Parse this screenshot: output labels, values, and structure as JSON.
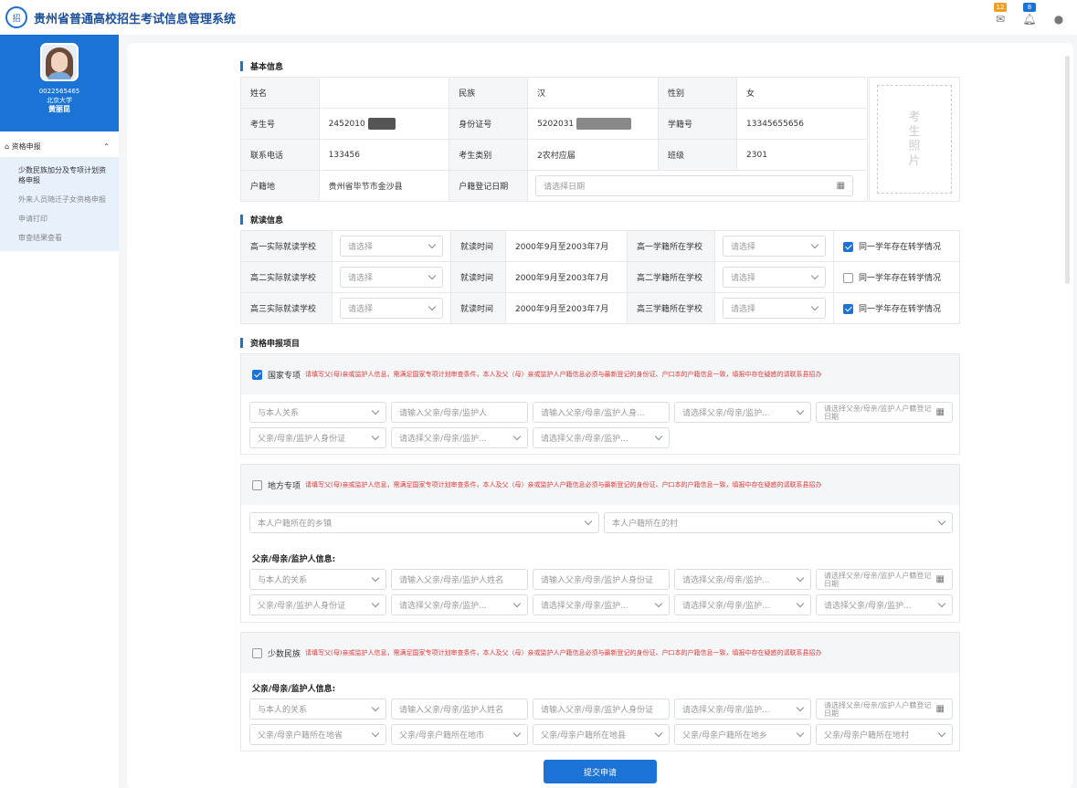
{
  "header": {
    "logo_text": "招",
    "title": "贵州省普通高校招生考试信息管理系统",
    "mail_badge": "12",
    "bell_badge": "8"
  },
  "sidebar": {
    "exam_id": "0022565465",
    "school": "北京大学",
    "name": "黄丽昆",
    "menu_head": "资格申报",
    "items": [
      {
        "label": "少数民族加分及专项计划资格申报"
      },
      {
        "label": "外来人员随迁子女资格申报"
      },
      {
        "label": "申请打印"
      },
      {
        "label": "审查结果查看"
      }
    ]
  },
  "basic": {
    "title": "基本信息",
    "name_label": "姓名",
    "ethnic_label": "民族",
    "ethnic": "汉",
    "gender_label": "性别",
    "gender": "女",
    "exam_no_label": "考生号",
    "exam_no": "2452010",
    "idcard_label": "身份证号",
    "idcard": "5202031",
    "student_no_label": "学籍号",
    "student_no": "13345655656",
    "phone_label": "联系电话",
    "phone": "133456",
    "category_label": "考生类别",
    "category": "2农村应届",
    "class_label": "班级",
    "class": "2301",
    "hukou_label": "户籍地",
    "hukou": "贵州省毕节市金沙县",
    "hukou_date_label": "户籍登记日期",
    "hukou_date_placeholder": "请选择日期",
    "photo": [
      "考",
      "生",
      "照",
      "片"
    ]
  },
  "study": {
    "title": "就读信息",
    "rows": [
      {
        "school_label": "高一实际就读学校",
        "time_label": "就读时间",
        "time": "2000年9月至2003年7月",
        "roll_label": "高一学籍所在学校",
        "transfer_label": "同一学年存在转学情况",
        "checked": true
      },
      {
        "school_label": "高二实际就读学校",
        "time_label": "就读时间",
        "time": "2000年9月至2003年7月",
        "roll_label": "高二学籍所在学校",
        "transfer_label": "同一学年存在转学情况",
        "checked": false
      },
      {
        "school_label": "高三实际就读学校",
        "time_label": "就读时间",
        "time": "2000年9月至2003年7月",
        "roll_label": "高三学籍所在学校",
        "transfer_label": "同一学年存在转学情况",
        "checked": true
      }
    ],
    "select_placeholder": "请选择"
  },
  "apply": {
    "title": "资格申报项目",
    "national": {
      "label": "国家专项",
      "checked": true,
      "note": "请填写父(母)亲或监护人信息，需满足国家专项计划审查条件，本人及父（母）亲或监护人户籍信息必须与最新登记的身份证、户口本的户籍信息一致，填报中存在疑惑的请联系县招办",
      "row1": [
        "与本人关系",
        "请输入父亲/母亲/监护人",
        "请输入父亲/母亲/监护人身...",
        "请选择父亲/母亲/监护...",
        "请选择父亲/母亲/监护人户籍登记日期"
      ],
      "row2": [
        "父亲/母亲/监护人身份证",
        "请选择父亲/母亲/监护...",
        "请选择父亲/母亲/监护..."
      ]
    },
    "local": {
      "label": "地方专项",
      "checked": false,
      "note": "请填写父(母)亲或监护人信息，需满足国家专项计划审查条件，本人及父（母）亲或监护人户籍信息必须与最新登记的身份证、户口本的户籍信息一致，填报中存在疑惑的请联系县招办",
      "town": "本人户籍所在的乡镇",
      "village": "本人户籍所在的村",
      "parent_header": "父亲/母亲/监护人信息:",
      "row1": [
        "与本人的关系",
        "请输入父亲/母亲/监护人姓名",
        "请输入父亲/母亲/监护人身份证",
        "请选择父亲/母亲/监护...",
        "请选择父亲/母亲/监护人户籍登记日期"
      ],
      "row2": [
        "父亲/母亲/监护人身份证",
        "请选择父亲/母亲/监护...",
        "请选择父亲/母亲/监护...",
        "请选择父亲/母亲/监护...",
        "请选择父亲/母亲/监护..."
      ]
    },
    "minority": {
      "label": "少数民族",
      "checked": false,
      "note": "请填写父(母)亲或监护人信息，需满足国家专项计划审查条件，本人及父（母）亲或监护人户籍信息必须与最新登记的身份证、户口本的户籍信息一致，填报中存在疑惑的请联系县招办",
      "parent_header": "父亲/母亲/监护人信息:",
      "row1": [
        "与本人的关系",
        "请输入父亲/母亲/监护人姓名",
        "请输入父亲/母亲/监护人身份证",
        "请选择父亲/母亲/监护...",
        "请选择父亲/母亲/监护人户籍登记日期"
      ],
      "row2": [
        "父亲/母亲户籍所在地省",
        "父亲/母亲户籍所在地市",
        "父亲/母亲户籍所在地县",
        "父亲/母亲户籍所在地乡",
        "父亲/母亲户籍所在地村"
      ]
    },
    "submit": "提交申请"
  }
}
